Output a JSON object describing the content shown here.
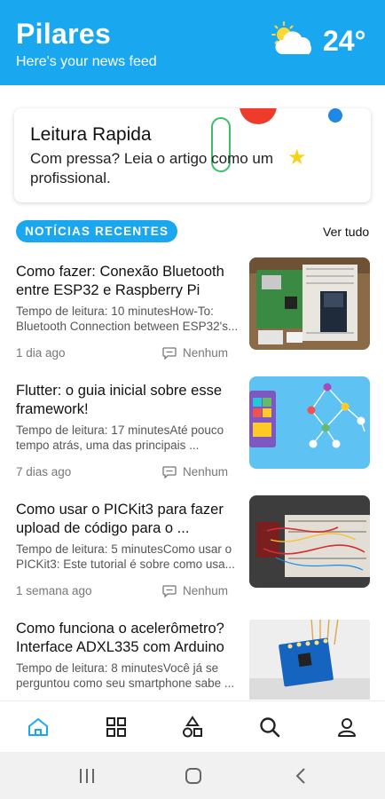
{
  "header": {
    "title": "Pilares",
    "subtitle": "Here's your news feed",
    "temperature": "24°",
    "weather_icon": "partly-cloudy-icon"
  },
  "quick_read": {
    "title": "Leitura Rapida",
    "text": "Com pressa? Leia o artigo como um profissional."
  },
  "section": {
    "label": "NOTÍCIAS RECENTES",
    "see_all": "Ver tudo"
  },
  "articles": [
    {
      "title": "Como fazer: Conexão Bluetooth entre ESP32 e Raspberry Pi",
      "excerpt": "Tempo de leitura: 10 minutesHow-To: Bluetooth Connection between ESP32's...",
      "date": "1 dia ago",
      "comments": "Nenhum"
    },
    {
      "title": "Flutter: o guia inicial sobre esse framework!",
      "excerpt": "Tempo de leitura: 17 minutesAté pouco tempo atrás, uma das principais ...",
      "date": "7 dias ago",
      "comments": "Nenhum"
    },
    {
      "title": "Como usar o PICKit3 para fazer upload de código para o ...",
      "excerpt": "Tempo de leitura: 5 minutesComo usar o PICKit3: Este tutorial é sobre como usa...",
      "date": "1 semana ago",
      "comments": "Nenhum"
    },
    {
      "title": "Como funciona o acelerômetro? Interface ADXL335 com Arduino",
      "excerpt": "Tempo de leitura: 8 minutesVocê já se perguntou como seu smartphone sabe ...",
      "date": "",
      "comments": ""
    }
  ],
  "bottom_nav": [
    "home-icon",
    "grid-icon",
    "shapes-icon",
    "search-icon",
    "profile-icon"
  ],
  "colors": {
    "accent": "#19a7f0",
    "nav_active": "#1aa7ef",
    "nav_inactive": "#222222"
  }
}
